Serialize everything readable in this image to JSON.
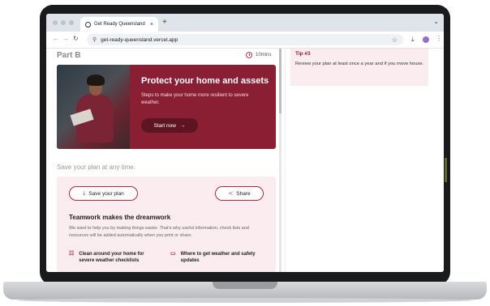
{
  "browser": {
    "tab_title": "Get Ready Queensland",
    "tab_close": "×",
    "new_tab": "+",
    "url": "get-ready-queensland.vercel.app",
    "nav": {
      "back": "←",
      "forward": "→",
      "reload": "↻"
    }
  },
  "page": {
    "part_title": "Part B",
    "timer": "10mins",
    "hero": {
      "title": "Protect your home and assets",
      "text": "Steps to make your home more resilient to severe weather.",
      "button": "Start now",
      "button_arrow": "→"
    },
    "save_line": "Save your plan at any time.",
    "panel": {
      "save_button": "Save your plan",
      "share_button": "Share",
      "team_title": "Teamwork makes the dreamwork",
      "team_text": "We want to help you by making things easier. That's why useful information, check lists and resources will be added automatically when you print or share.",
      "features": [
        {
          "icon": "list-icon",
          "label": "Clean around your home for severe weather checklists"
        },
        {
          "icon": "chat-icon",
          "label": "Where to get weather and safety updates"
        }
      ]
    }
  },
  "sidebar": {
    "tip_title": "Tip #3",
    "tip_text": "Review your plan at least once a year and if you move house."
  },
  "colors": {
    "brand": "#8a1f34",
    "accent": "#b3283e",
    "panel": "#fbecef"
  }
}
